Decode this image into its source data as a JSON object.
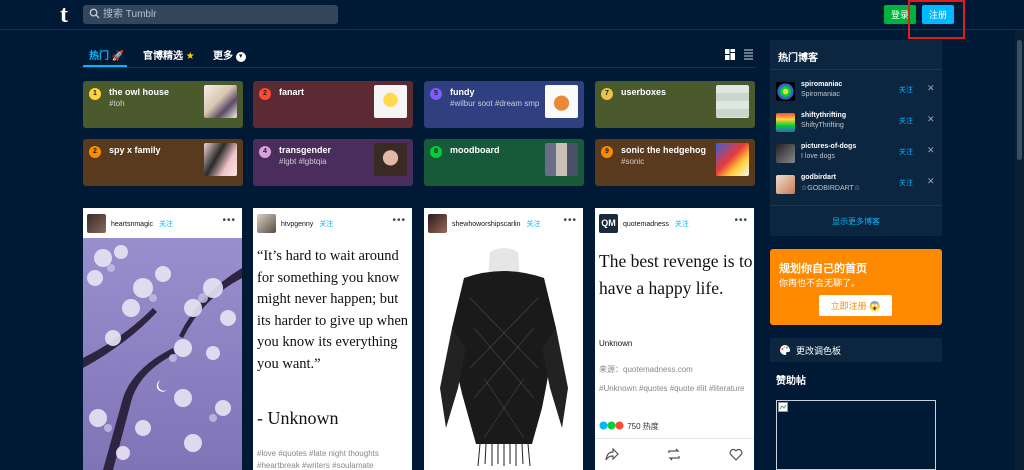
{
  "header": {
    "logo": "t",
    "search_placeholder": "搜索 Tumblr",
    "login_label": "登录",
    "signup_label": "注册"
  },
  "tabs": [
    {
      "label": "热门"
    },
    {
      "label": "官博精选"
    },
    {
      "label": "更多"
    }
  ],
  "tags": [
    {
      "num": "1",
      "name": "the owl house",
      "sub": "#toh",
      "bg": "#4a5a2c",
      "dot": "#ffd33d"
    },
    {
      "num": "2",
      "name": "fanart",
      "sub": "",
      "bg": "#5b2a33",
      "dot": "#ff4930"
    },
    {
      "num": "5",
      "name": "fundy",
      "sub": "#wilbur soot #dream smp",
      "bg": "#2f3f80",
      "dot": "#7c5cff"
    },
    {
      "num": "7",
      "name": "userboxes",
      "sub": "",
      "bg": "#4a5a2c",
      "dot": "#e8c547"
    },
    {
      "num": "2",
      "name": "spy x family",
      "sub": "",
      "bg": "#5a3a1e",
      "dot": "#ff8a00"
    },
    {
      "num": "4",
      "name": "transgender",
      "sub": "#lgbt #lgbtqia",
      "bg": "#4a2d5c",
      "dot": "#d9a0e0"
    },
    {
      "num": "8",
      "name": "moodboard",
      "sub": "",
      "bg": "#165a3a",
      "dot": "#00cf35"
    },
    {
      "num": "9",
      "name": "sonic the hedgehog",
      "sub": "#sonic",
      "bg": "#5a3a1e",
      "dot": "#ff8a00"
    }
  ],
  "posts": [
    {
      "user": "heartsnmagic",
      "follow": "关注"
    },
    {
      "user": "htvpgenny",
      "follow": "关注",
      "quote": "“It’s hard to wait around for something you know might never happen; but its harder to give up when you know its everything you want.”",
      "source": "- Unknown",
      "tags": "#love   #quotes   #late night thoughts   #heartbreak   #writers   #soulamate"
    },
    {
      "user": "shewhoworshipscarlin",
      "follow": "关注"
    },
    {
      "user": "quotemadness",
      "follow": "关注",
      "quote": "The best revenge is to have a happy life.",
      "author": "Unknown",
      "source": "来源：quotemadness.com",
      "tags": "#Unknown   #quotes   #quote   #lit   #literature",
      "notes": "750 热度"
    }
  ],
  "sidebar": {
    "title": "热门博客",
    "bloggers": [
      {
        "name": "spiromaniac",
        "desc": "Spiromaniac",
        "follow": "关注"
      },
      {
        "name": "shiftythrifting",
        "desc": "ShiftyThrifting",
        "follow": "关注"
      },
      {
        "name": "pictures-of-dogs",
        "desc": "I love dogs",
        "follow": "关注"
      },
      {
        "name": "godbirdart",
        "desc": "☆GODBIRDART☆",
        "follow": "关注"
      }
    ],
    "more_label": "显示更多博客",
    "promo_title": "规划你自己的首页",
    "promo_sub": "你再也不会无聊了。",
    "promo_button": "立即注册 😱",
    "palette_label": "更改调色板",
    "sponsor_title": "赞助帖"
  },
  "colors": {
    "background": "#001935",
    "accent": "#00b8ff",
    "login": "#00b33c",
    "promo": "#ff8a00",
    "annotation": "#e01c1c"
  }
}
